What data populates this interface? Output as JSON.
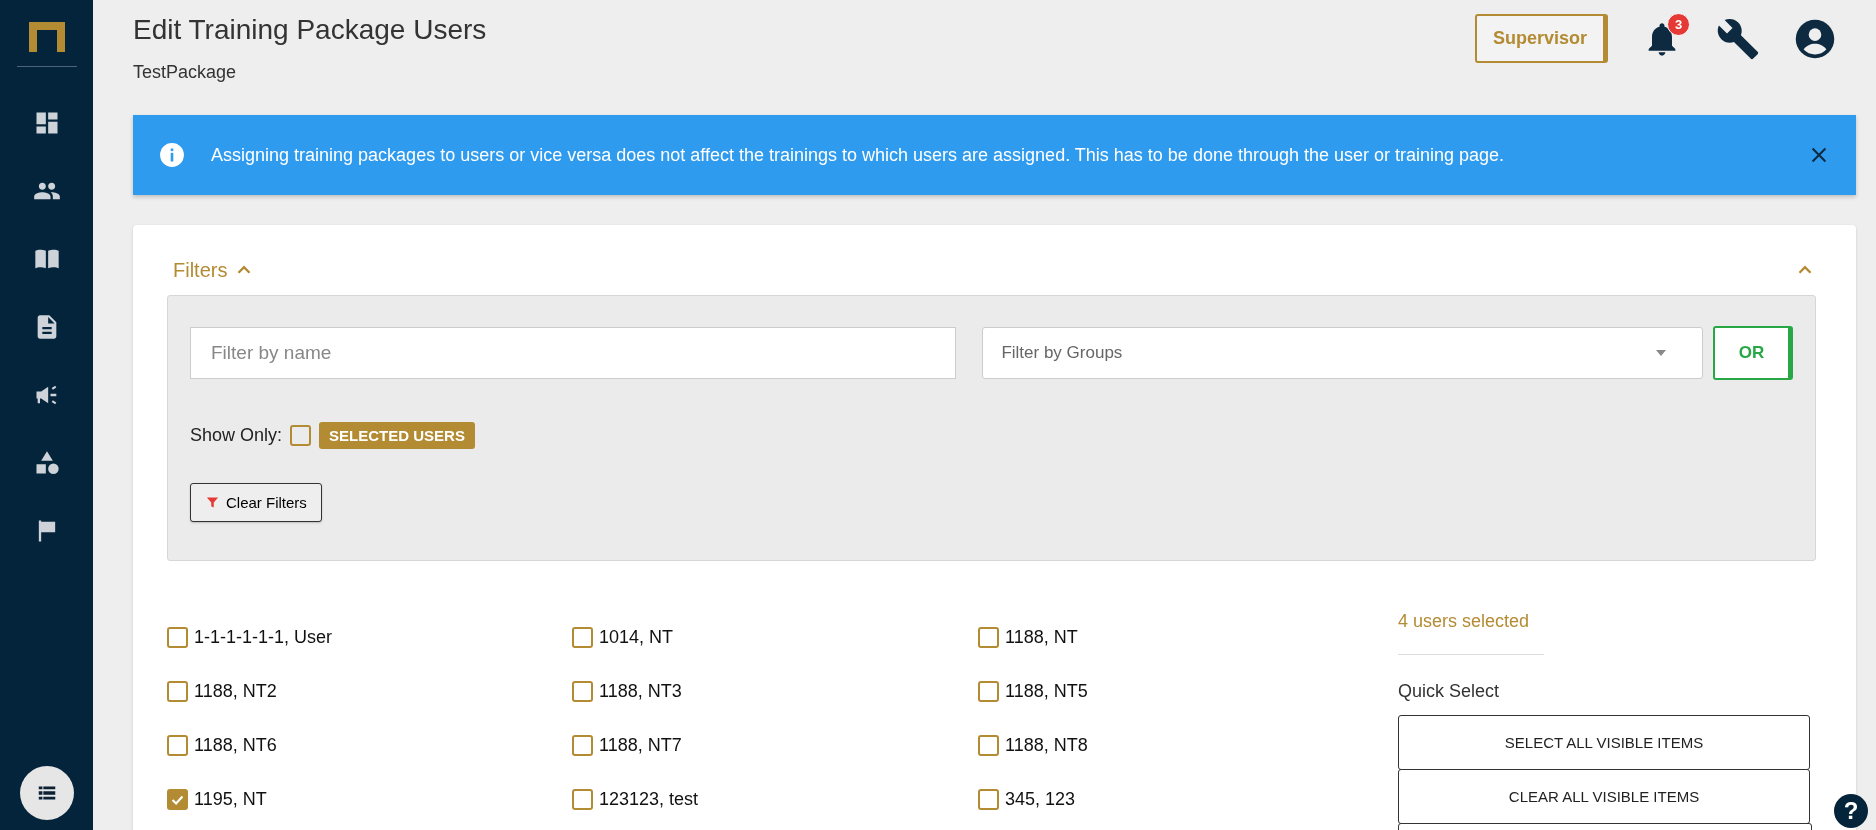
{
  "header": {
    "title": "Edit Training Package Users",
    "subtitle": "TestPackage",
    "role_button": "Supervisor",
    "notification_count": "3"
  },
  "banner": {
    "text": "Assigning training packages to users or vice versa does not affect the trainings to which users are assigned. This has to be done through the user or training page."
  },
  "filters": {
    "label": "Filters",
    "expanded": true,
    "name_placeholder": "Filter by name",
    "groups_placeholder": "Filter by Groups",
    "operator_button": "OR",
    "show_only_label": "Show Only:",
    "selected_only_checked": false,
    "selected_only_tag": "SELECTED USERS",
    "clear_button": "Clear Filters"
  },
  "users": [
    {
      "name": "1-1-1-1-1-1, User",
      "checked": false
    },
    {
      "name": "1014, NT",
      "checked": false
    },
    {
      "name": "1188, NT",
      "checked": false
    },
    {
      "name": "1188, NT2",
      "checked": false
    },
    {
      "name": "1188, NT3",
      "checked": false
    },
    {
      "name": "1188, NT5",
      "checked": false
    },
    {
      "name": "1188, NT6",
      "checked": false
    },
    {
      "name": "1188, NT7",
      "checked": false
    },
    {
      "name": "1188, NT8",
      "checked": false
    },
    {
      "name": "1195, NT",
      "checked": true
    },
    {
      "name": "123123, test",
      "checked": false
    },
    {
      "name": "345, 123",
      "checked": false
    }
  ],
  "selection": {
    "count_text": "4 users selected",
    "quick_select_label": "Quick Select",
    "buttons": [
      "SELECT ALL VISIBLE ITEMS",
      "CLEAR ALL VISIBLE ITEMS"
    ]
  },
  "help_button": "?"
}
